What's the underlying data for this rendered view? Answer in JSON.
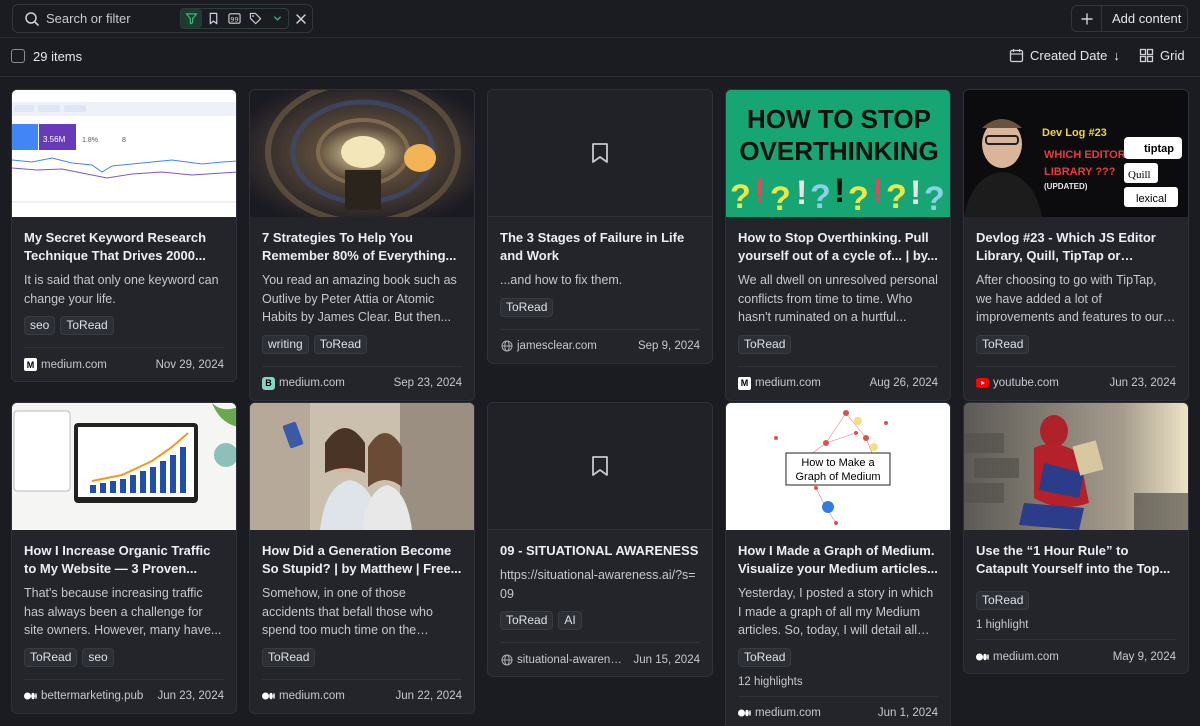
{
  "search": {
    "placeholder": "Search or filter"
  },
  "filters": [
    {
      "icon": "funnel-icon",
      "active": true
    },
    {
      "icon": "bookmark-icon",
      "active": false
    },
    {
      "icon": "quote-icon",
      "active": false
    },
    {
      "icon": "tag-icon",
      "active": false
    },
    {
      "icon": "chevron-down-icon",
      "active": false
    }
  ],
  "add_content": {
    "label": "Add content"
  },
  "toolbar": {
    "items_count": "29 items",
    "sort_label": "Created Date",
    "sort_dir": "↓",
    "view_label": "Grid"
  },
  "colors": {
    "background": "#1b1c21",
    "card": "#23252b",
    "accent": "#3bb67a"
  },
  "cards": [
    {
      "title": "My Secret Keyword Research Technique That Drives 2000...",
      "description": "It is said that only one keyword can change your life.",
      "tags": [
        "seo",
        "ToRead"
      ],
      "highlights": "",
      "source": "medium.com",
      "source_icon": "medium-icon",
      "date": "Nov 29, 2024",
      "thumb_text": [
        "3.56M",
        "1.8%",
        "8"
      ]
    },
    {
      "title": "7 Strategies To Help You Remember 80% of Everything...",
      "description": "You read an amazing book such as Outlive by Peter Attia or Atomic Habits by James Clear. But then...",
      "tags": [
        "writing",
        "ToRead"
      ],
      "highlights": "",
      "source": "medium.com",
      "source_icon": "medium-b-icon",
      "date": "Sep 23, 2024"
    },
    {
      "title": "The 3 Stages of Failure in Life and Work",
      "description": "...and how to fix them.",
      "tags": [
        "ToRead"
      ],
      "highlights": "",
      "source": "jamesclear.com",
      "source_icon": "globe-icon",
      "date": "Sep 9, 2024"
    },
    {
      "title": "How to Stop Overthinking. Pull yourself out of a cycle of... | by...",
      "description": "We all dwell on unresolved personal conflicts from time to time. Who hasn't ruminated on a hurtful...",
      "tags": [
        "ToRead"
      ],
      "highlights": "",
      "source": "medium.com",
      "source_icon": "medium-icon",
      "date": "Aug 26, 2024",
      "thumb_text": [
        "HOW TO STOP",
        "OVERTHINKING"
      ]
    },
    {
      "title": "Devlog #23 - Which JS Editor Library, Quill, TipTap or Lexical...",
      "description": "After choosing to go with TipTap, we have added a lot of improvements and features to our implementation...",
      "tags": [
        "ToRead"
      ],
      "highlights": "",
      "source": "youtube.com",
      "source_icon": "youtube-icon",
      "date": "Jun 23, 2024",
      "thumb_text": [
        "Dev Log #23",
        "WHICH EDITOR",
        "LIBRARY ???",
        "(UPDATED)",
        "tiptap",
        "Quill",
        "lexical"
      ]
    },
    {
      "title": "How I Increase Organic Traffic to My Website — 3 Proven...",
      "description": "That's because increasing traffic has always been a challenge for site owners. However, many have...",
      "tags": [
        "ToRead",
        "seo"
      ],
      "highlights": "",
      "source": "bettermarketing.pub",
      "source_icon": "medium-dots-icon",
      "date": "Jun 23, 2024"
    },
    {
      "title": "How Did a Generation Become So Stupid? | by Matthew | Free...",
      "description": "Somehow, in one of those accidents that befall those who spend too much time on the Internet without...",
      "tags": [
        "ToRead"
      ],
      "highlights": "",
      "source": "medium.com",
      "source_icon": "medium-dots-icon",
      "date": "Jun 22, 2024"
    },
    {
      "title": "09 - SITUATIONAL AWARENESS",
      "description": "https://situational-awareness.ai/?s=09",
      "tags": [
        "ToRead",
        "AI"
      ],
      "highlights": "",
      "source": "situational-awarene...",
      "source_icon": "globe-icon",
      "date": "Jun 15, 2024"
    },
    {
      "title": "How I Made a Graph of Medium. Visualize your Medium articles...",
      "description": "Yesterday, I posted a story in which I made a graph of all my Medium articles. So, today, I will detail all th...",
      "tags": [
        "ToRead"
      ],
      "highlights": "12 highlights",
      "source": "medium.com",
      "source_icon": "medium-dots-icon",
      "date": "Jun 1, 2024",
      "thumb_text": [
        "How to Make a",
        "Graph of Medium"
      ]
    },
    {
      "title": "Use the “1 Hour Rule” to Catapult Yourself into the Top...",
      "description": "",
      "tags": [
        "ToRead"
      ],
      "highlights": "1 highlight",
      "source": "medium.com",
      "source_icon": "medium-dots-icon",
      "date": "May 9, 2024"
    }
  ]
}
